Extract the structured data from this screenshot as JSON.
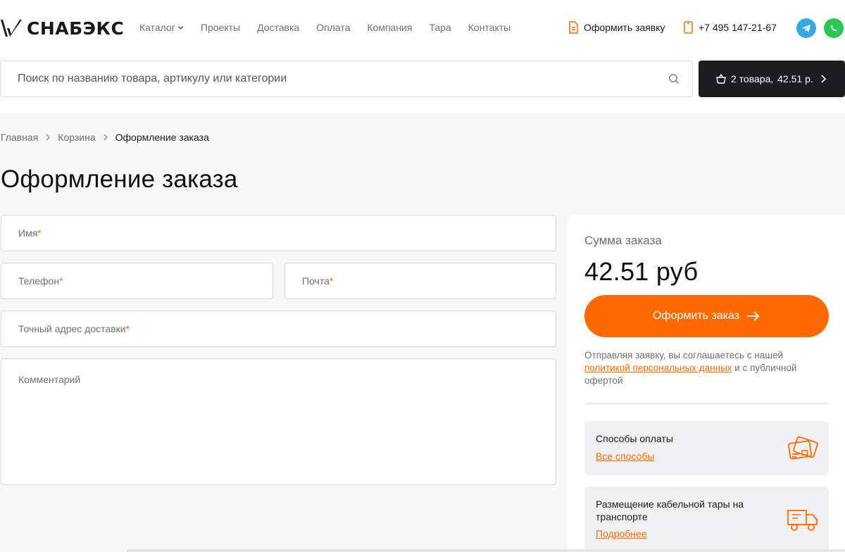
{
  "brand": {
    "name": "СНАБЭКС"
  },
  "nav": [
    {
      "label": "Каталог",
      "has_dropdown": true
    },
    {
      "label": "Проекты"
    },
    {
      "label": "Доставка"
    },
    {
      "label": "Оплата"
    },
    {
      "label": "Компания"
    },
    {
      "label": "Тара"
    },
    {
      "label": "Контакты"
    }
  ],
  "header": {
    "apply_label": "Оформить заявку",
    "phone": "+7 495 147-21-67",
    "social": [
      "telegram-icon",
      "whatsapp-icon"
    ]
  },
  "search": {
    "placeholder": "Поиск по названию товара, артикулу или категории"
  },
  "cart": {
    "items_label": "2 товара,",
    "total_label": "42.51 р."
  },
  "breadcrumbs": [
    "Главная",
    "Корзина",
    "Оформление заказа"
  ],
  "page_title": "Оформление заказа",
  "form": {
    "name_label": "Имя",
    "phone_label": "Телефон",
    "email_label": "Почта",
    "address_label": "Точный адрес доставки",
    "comment_label": "Комментарий",
    "required_mark": "*"
  },
  "summary": {
    "label": "Сумма заказа",
    "amount": "42.51 руб",
    "button_label": "Оформить заказ",
    "consent_pre": "Отправляя заявку, вы соглашаетесь с нашей ",
    "consent_link": "политикой персональных данных",
    "consent_post": " и с публичной офертой"
  },
  "cards": {
    "payment": {
      "title": "Способы оплаты",
      "link": "Все способы",
      "icon": "credit-card-icon"
    },
    "shipping": {
      "title": "Размещение кабельной тары на транспорте",
      "link": "Подробнее",
      "icon": "truck-icon"
    }
  },
  "colors": {
    "accent": "#ff6a00",
    "dark": "#1c1c21",
    "telegram": "#38a8e3",
    "whatsapp": "#2bc653"
  }
}
